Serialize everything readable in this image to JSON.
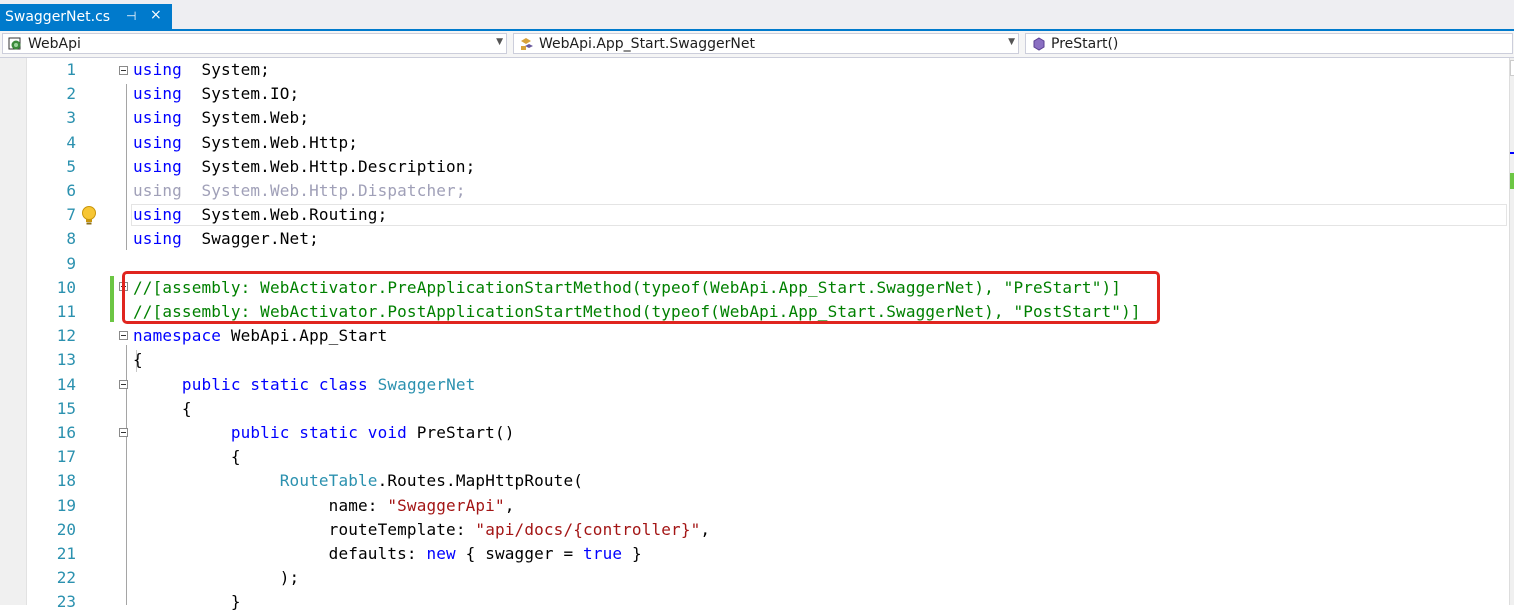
{
  "tab": {
    "title": "SwaggerNet.cs",
    "pin_glyph": "⊣",
    "close_glyph": "×"
  },
  "nav": {
    "project": "WebApi",
    "type": "WebApi.App_Start.SwaggerNet",
    "member": "PreStart()"
  },
  "icons": [
    "project-icon",
    "class-icon",
    "method-icon",
    "lightbulb-icon",
    "dropdown-arrow-icon",
    "pin-icon",
    "close-icon",
    "collapse-icon"
  ],
  "colors": {
    "keyword": "#0000ff",
    "comment": "#008000",
    "string": "#a31515",
    "type": "#2b91af",
    "accent": "#007acc",
    "highlight": "#e0251f"
  },
  "code_lines": [
    {
      "n": "1",
      "parts": [
        [
          "kw",
          "using"
        ],
        [
          "",
          "  System;"
        ]
      ]
    },
    {
      "n": "2",
      "parts": [
        [
          "kw",
          "using"
        ],
        [
          "",
          "  System.IO;"
        ]
      ]
    },
    {
      "n": "3",
      "parts": [
        [
          "kw",
          "using"
        ],
        [
          "",
          "  System.Web;"
        ]
      ]
    },
    {
      "n": "4",
      "parts": [
        [
          "kw",
          "using"
        ],
        [
          "",
          "  System.Web.Http;"
        ]
      ]
    },
    {
      "n": "5",
      "parts": [
        [
          "kw",
          "using"
        ],
        [
          "",
          "  System.Web.Http.Description;"
        ]
      ]
    },
    {
      "n": "6",
      "parts": [
        [
          "dim",
          "using  System.Web.Http.Dispatcher;"
        ]
      ]
    },
    {
      "n": "7",
      "parts": [
        [
          "kw",
          "using"
        ],
        [
          "",
          "  System.Web.Routing;"
        ]
      ]
    },
    {
      "n": "8",
      "parts": [
        [
          "kw",
          "using"
        ],
        [
          "",
          "  Swagger.Net;"
        ]
      ]
    },
    {
      "n": "9",
      "parts": []
    },
    {
      "n": "10",
      "parts": [
        [
          "cm",
          "//[assembly: WebActivator.PreApplicationStartMethod(typeof(WebApi.App_Start.SwaggerNet), \"PreStart\")]"
        ]
      ]
    },
    {
      "n": "11",
      "parts": [
        [
          "cm",
          "//[assembly: WebActivator.PostApplicationStartMethod(typeof(WebApi.App_Start.SwaggerNet), \"PostStart\")]"
        ]
      ]
    },
    {
      "n": "12",
      "parts": [
        [
          "kw",
          "namespace"
        ],
        [
          "",
          " WebApi.App_Start"
        ]
      ]
    },
    {
      "n": "13",
      "parts": [
        [
          "",
          "{"
        ]
      ]
    },
    {
      "n": "14",
      "parts": [
        [
          "",
          "     "
        ],
        [
          "kw",
          "public static class"
        ],
        [
          "",
          " "
        ],
        [
          "ty",
          "SwaggerNet"
        ]
      ]
    },
    {
      "n": "15",
      "parts": [
        [
          "",
          "     {"
        ]
      ]
    },
    {
      "n": "16",
      "parts": [
        [
          "",
          "          "
        ],
        [
          "kw",
          "public static void"
        ],
        [
          "",
          " PreStart()"
        ]
      ]
    },
    {
      "n": "17",
      "parts": [
        [
          "",
          "          {"
        ]
      ]
    },
    {
      "n": "18",
      "parts": [
        [
          "",
          "               "
        ],
        [
          "ty",
          "RouteTable"
        ],
        [
          "",
          ".Routes.MapHttpRoute("
        ]
      ]
    },
    {
      "n": "19",
      "parts": [
        [
          "",
          "                    name: "
        ],
        [
          "st",
          "\"SwaggerApi\""
        ],
        [
          "",
          ","
        ]
      ]
    },
    {
      "n": "20",
      "parts": [
        [
          "",
          "                    routeTemplate: "
        ],
        [
          "st",
          "\"api/docs/{controller}\""
        ],
        [
          "",
          ","
        ]
      ]
    },
    {
      "n": "21",
      "parts": [
        [
          "",
          "                    defaults: "
        ],
        [
          "kw",
          "new"
        ],
        [
          "",
          " { swagger = "
        ],
        [
          "kw",
          "true"
        ],
        [
          "",
          " }"
        ]
      ]
    },
    {
      "n": "22",
      "parts": [
        [
          "",
          "               );"
        ]
      ]
    },
    {
      "n": "23",
      "parts": [
        [
          "",
          "          }"
        ]
      ]
    }
  ]
}
